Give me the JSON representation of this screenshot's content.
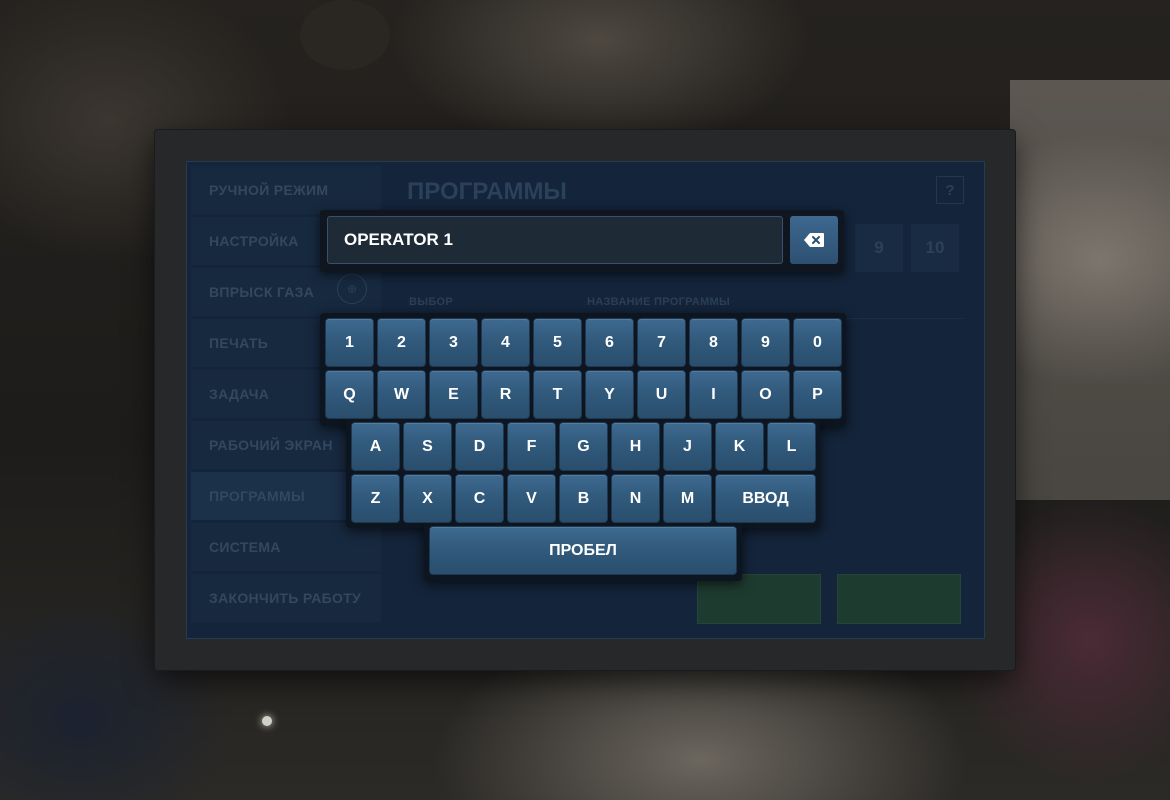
{
  "app": {
    "page_title": "ПРОГРАММЫ",
    "help_label": "?",
    "sidebar": {
      "items": [
        {
          "label": "РУЧНОЙ РЕЖИМ"
        },
        {
          "label": "НАСТРОЙКА"
        },
        {
          "label": "ВПРЫСК ГАЗА"
        },
        {
          "label": "ПЕЧАТЬ"
        },
        {
          "label": "ЗАДАЧА"
        },
        {
          "label": "РАБОЧИЙ ЭКРАН"
        },
        {
          "label": "ПРОГРАММЫ"
        },
        {
          "label": "СИСТЕМА"
        },
        {
          "label": "ЗАКОНЧИТЬ РАБОТУ"
        }
      ]
    },
    "page_tabs": [
      "9",
      "10"
    ],
    "columns": {
      "select": "ВЫБОР",
      "program_name": "НАЗВАНИЕ ПРОГРАММЫ"
    }
  },
  "keyboard": {
    "input_value": "OPERATOR 1",
    "backspace_icon": "backspace-icon",
    "row_digits": [
      "1",
      "2",
      "3",
      "4",
      "5",
      "6",
      "7",
      "8",
      "9",
      "0"
    ],
    "row_top": [
      "Q",
      "W",
      "E",
      "R",
      "T",
      "Y",
      "U",
      "I",
      "O",
      "P"
    ],
    "row_middle": [
      "A",
      "S",
      "D",
      "F",
      "G",
      "H",
      "J",
      "K",
      "L"
    ],
    "row_bottom": [
      "Z",
      "X",
      "C",
      "V",
      "B",
      "N",
      "M"
    ],
    "enter_label": "ВВОД",
    "space_label": "ПРОБЕЛ"
  },
  "colors": {
    "key_top": "#3f6a91",
    "key_bottom": "#2a4e6d",
    "screen_bg": "#14243a"
  }
}
